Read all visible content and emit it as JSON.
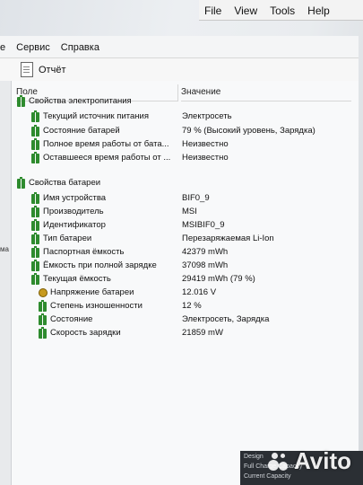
{
  "back_window": {
    "menu": [
      "File",
      "View",
      "Tools",
      "Help"
    ]
  },
  "menubar": {
    "left_fragment": "е",
    "items": [
      "Сервис",
      "Справка"
    ]
  },
  "toolbar": {
    "report_label": "Отчёт"
  },
  "left_strip_label": "ма",
  "columns": {
    "field": "Поле",
    "value": "Значение"
  },
  "rows": [
    {
      "type": "group",
      "label": "Свойства электропитания",
      "value": "",
      "icon": "battery-icon"
    },
    {
      "type": "item",
      "label": "Текущий источник питания",
      "value": "Электросеть",
      "icon": "battery-icon"
    },
    {
      "type": "item",
      "label": "Состояние батарей",
      "value": "79 % (Высокий уровень, Зарядка)",
      "icon": "battery-icon"
    },
    {
      "type": "item",
      "label": "Полное время работы от бата...",
      "value": "Неизвестно",
      "icon": "battery-icon"
    },
    {
      "type": "item",
      "label": "Оставшееся время работы от ...",
      "value": "Неизвестно",
      "icon": "battery-icon"
    },
    {
      "type": "group",
      "label": "Свойства батареи",
      "value": "",
      "icon": "battery-icon"
    },
    {
      "type": "item",
      "label": "Имя устройства",
      "value": "BIF0_9",
      "icon": "battery-icon"
    },
    {
      "type": "item",
      "label": "Производитель",
      "value": "MSI",
      "icon": "battery-icon"
    },
    {
      "type": "item",
      "label": "Идентификатор",
      "value": "MSIBIF0_9",
      "icon": "battery-icon"
    },
    {
      "type": "item",
      "label": "Тип батареи",
      "value": "Перезаряжаемая Li-Ion",
      "icon": "battery-icon"
    },
    {
      "type": "item",
      "label": "Паспортная ёмкость",
      "value": "42379 mWh",
      "icon": "battery-icon"
    },
    {
      "type": "item",
      "label": "Ёмкость при полной зарядке",
      "value": "37098 mWh",
      "icon": "battery-icon"
    },
    {
      "type": "item",
      "label": "Текущая ёмкость",
      "value": "29419 mWh  (79 %)",
      "icon": "battery-icon"
    },
    {
      "type": "item",
      "label": "Напряжение батареи",
      "value": "12.016 V",
      "icon": "voltage-icon"
    },
    {
      "type": "item",
      "label": "Степень изношенности",
      "value": "12 %",
      "icon": "battery-icon"
    },
    {
      "type": "item",
      "label": "Состояние",
      "value": "Электросеть, Зарядка",
      "icon": "battery-icon"
    },
    {
      "type": "item",
      "label": "Скорость зарядки",
      "value": "21859 mW",
      "icon": "battery-icon"
    }
  ],
  "bottom_window": {
    "lines": [
      "Design",
      "Full Charge Capacity",
      "Current Capacity"
    ]
  },
  "watermark": "Avito"
}
